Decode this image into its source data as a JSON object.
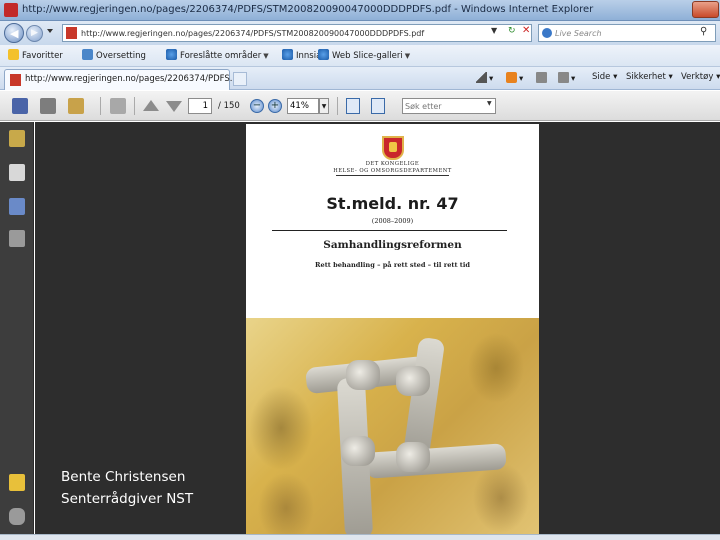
{
  "window": {
    "title": "http://www.regjeringen.no/pages/2206374/PDFS/STM200820090047000DDDPDFS.pdf - Windows Internet Explorer"
  },
  "address_bar": {
    "url": "http://www.regjeringen.no/pages/2206374/PDFS/STM200820090047000DDDPDFS.pdf",
    "search_placeholder": "Live Search"
  },
  "favorites_bar": {
    "items": [
      {
        "label": "Favoritter",
        "icon": "star-icon"
      },
      {
        "label": "Oversetting",
        "icon": "translate-icon"
      },
      {
        "label": "Foreslåtte områder",
        "icon": "ie-icon"
      },
      {
        "label": "Innsia",
        "icon": "ie-icon"
      },
      {
        "label": "Web Slice-galleri",
        "icon": "ie-icon"
      }
    ]
  },
  "tab": {
    "label": "http://www.regjeringen.no/pages/2206374/PDFS..."
  },
  "commands": {
    "page": "Side",
    "security": "Sikkerhet",
    "tools": "Verktøy"
  },
  "pdf_toolbar": {
    "current_page": "1",
    "total_pages": "/ 150",
    "zoom": "41%",
    "find_placeholder": "Søk etter"
  },
  "document": {
    "ministry_line1": "DET KONGELIGE",
    "ministry_line2": "HELSE- OG OMSORGSDEPARTEMENT",
    "title": "St.meld. nr. 47",
    "years": "(2008–2009)",
    "subtitle": "Samhandlingsreformen",
    "tagline": "Rett behandling – på rett sted – til rett tid"
  },
  "caption": {
    "name": "Bente Christensen",
    "role": "Senterrådgiver NST"
  }
}
